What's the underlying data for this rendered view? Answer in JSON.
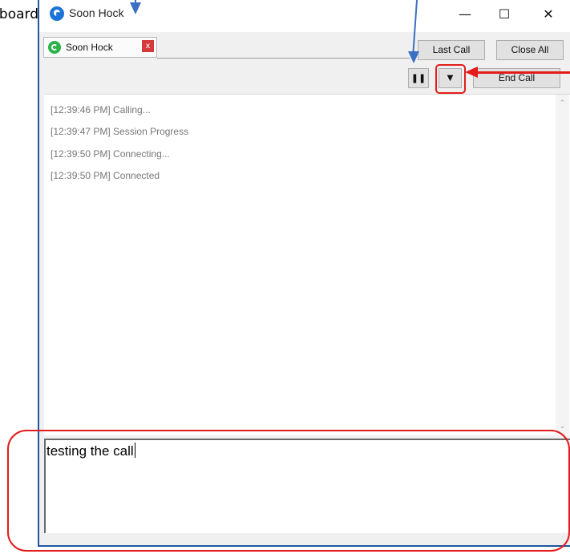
{
  "side_label": "Dashboard",
  "window": {
    "title": "Soon Hock",
    "minimize_glyph": "—",
    "maximize_glyph": "☐",
    "close_glyph": "✕"
  },
  "tab": {
    "label": "Soon Hock",
    "close_glyph": "x",
    "icon": "whatsapp-icon"
  },
  "toolbar": {
    "last_call": "Last Call",
    "close_all": "Close All",
    "pause_glyph": "❚❚",
    "dropdown_glyph": "▼",
    "end_call": "End Call"
  },
  "log": [
    "[12:39:46 PM] Calling...",
    "[12:39:47 PM] Session Progress",
    "[12:39:50 PM] Connecting...",
    "[12:39:50 PM] Connected"
  ],
  "scroll": {
    "up_glyph": "⌃",
    "down_glyph": "⌄"
  },
  "input": {
    "value": "testing the call"
  },
  "colors": {
    "annotation_blue": "#3b6fc4",
    "annotation_red": "#e41b1b",
    "window_border": "#1e56a0",
    "tab_close": "#d43a3a"
  }
}
